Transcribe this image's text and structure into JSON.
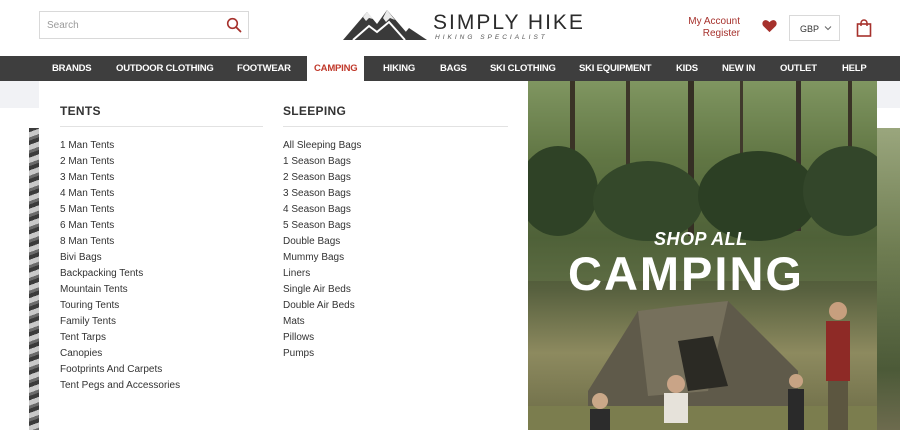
{
  "header": {
    "search_placeholder": "Search",
    "logo_title": "SIMPLY HIKE",
    "logo_subtitle": "HIKING SPECIALIST",
    "account_label": "My Account",
    "register_label": "Register",
    "currency": "GBP",
    "icons": {
      "search": "search-icon",
      "wishlist": "heart-icon",
      "currency_dropdown": "chevron-down-icon",
      "basket": "shopping-bag-icon"
    },
    "accent_color": "#a6312c"
  },
  "nav": {
    "items": [
      {
        "label": "BRANDS"
      },
      {
        "label": "OUTDOOR CLOTHING"
      },
      {
        "label": "FOOTWEAR"
      },
      {
        "label": "CAMPING"
      },
      {
        "label": "HIKING"
      },
      {
        "label": "BAGS"
      },
      {
        "label": "SKI CLOTHING"
      },
      {
        "label": "SKI EQUIPMENT"
      },
      {
        "label": "KIDS"
      },
      {
        "label": "NEW IN"
      },
      {
        "label": "OUTLET"
      },
      {
        "label": "HELP"
      }
    ],
    "active": "CAMPING",
    "background": "#3e3e3e",
    "active_color": "#c0392b"
  },
  "dropdown": {
    "columns": [
      {
        "title": "TENTS",
        "items": [
          "1 Man Tents",
          "2 Man Tents",
          "3 Man Tents",
          "4 Man Tents",
          "5 Man Tents",
          "6 Man Tents",
          "8 Man Tents",
          "Bivi Bags",
          "Backpacking Tents",
          "Mountain Tents",
          "Touring Tents",
          "Family Tents",
          "Tent Tarps",
          "Canopies",
          "Footprints And Carpets",
          "Tent Pegs and Accessories"
        ]
      },
      {
        "title": "SLEEPING",
        "items": [
          "All Sleeping Bags",
          "1 Season Bags",
          "2 Season Bags",
          "3 Season Bags",
          "4 Season Bags",
          "5 Season Bags",
          "Double Bags",
          "Mummy Bags",
          "Liners",
          "Single Air Beds",
          "Double Air Beds",
          "Mats",
          "Pillows",
          "Pumps"
        ]
      }
    ],
    "promo": {
      "kicker": "SHOP ALL",
      "title": "CAMPING"
    }
  }
}
